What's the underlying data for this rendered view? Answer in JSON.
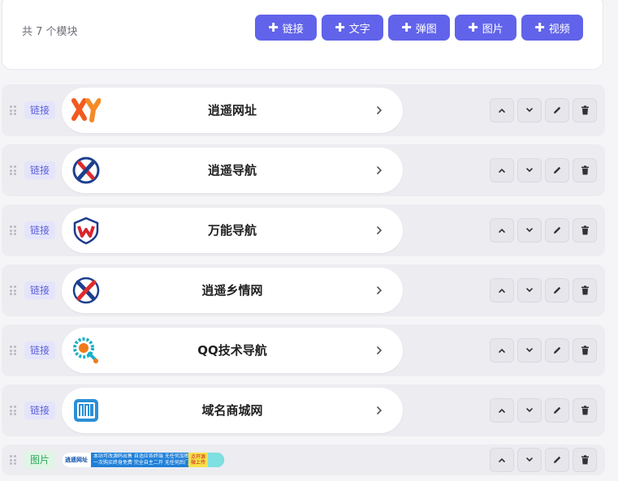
{
  "header": {
    "count_label": "共 7 个模块",
    "buttons": [
      {
        "label": "链接"
      },
      {
        "label": "文字"
      },
      {
        "label": "弹图"
      },
      {
        "label": "图片"
      },
      {
        "label": "视频"
      }
    ]
  },
  "modules": [
    {
      "tag": "链接",
      "title": "逍遥网址",
      "logo": "xy-logo"
    },
    {
      "tag": "链接",
      "title": "逍遥导航",
      "logo": "x-circle-logo"
    },
    {
      "tag": "链接",
      "title": "万能导航",
      "logo": "w-shield-logo"
    },
    {
      "tag": "链接",
      "title": "逍遥乡情网",
      "logo": "x-ribbon-logo"
    },
    {
      "tag": "链接",
      "title": "QQ技术导航",
      "logo": "q-magnifier-logo"
    },
    {
      "tag": "链接",
      "title": "域名商城网",
      "logo": "m-box-logo"
    },
    {
      "tag": "图片",
      "banner": {
        "name": "逍遥网址",
        "url": "http://xyk.cn",
        "line1": "本站可改源码出售 自适应各终端 无任何加密",
        "line2": "一次购买终身免费 完全自主二开 无任何后门",
        "badge1": "点开源",
        "badge2": "微上传"
      }
    }
  ],
  "colors": {
    "accent": "#6163ea",
    "link_tag_bg": "#e4e5fb",
    "image_tag_bg": "#e0f5e6",
    "row_bg": "#ececf1"
  }
}
